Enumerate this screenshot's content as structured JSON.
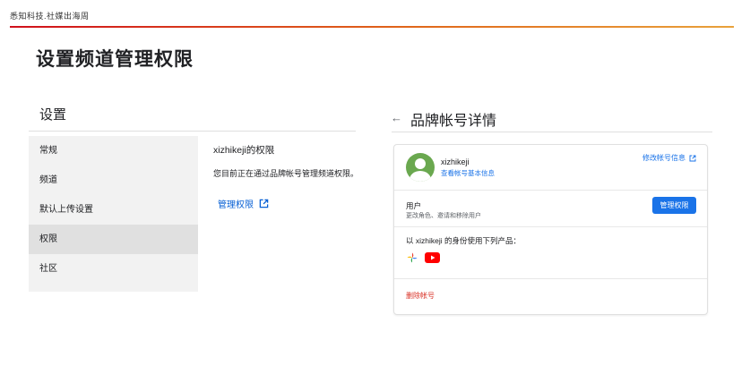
{
  "brand": "悉知科技.社媒出海周",
  "page_title": "设置频道管理权限",
  "settings": {
    "title": "设置",
    "nav": [
      {
        "label": "常规",
        "active": false
      },
      {
        "label": "频道",
        "active": false
      },
      {
        "label": "默认上传设置",
        "active": false
      },
      {
        "label": "权限",
        "active": true
      },
      {
        "label": "社区",
        "active": false
      }
    ],
    "permissions": {
      "title": "xizhikeji的权限",
      "desc": "您目前正在通过品牌帐号管理频道权限。",
      "manage_link": "管理权限"
    }
  },
  "brand_account": {
    "title": "品牌帐号详情",
    "account_name": "xizhikeji",
    "account_link": "查看帐号基本信息",
    "edit_link": "修改帐号信息",
    "users_label": "用户",
    "users_desc": "更改角色、邀请和移除用户",
    "manage_button": "管理权限",
    "products_label": "以 xizhikeji 的身份使用下列产品：",
    "products": [
      "google-photos-icon",
      "youtube-icon"
    ],
    "delete_link": "删除帐号"
  },
  "colors": {
    "accent": "#1a73e8",
    "delete": "#d93025",
    "avatar": "#6aa84f",
    "brand_rule_start": "#d0101c",
    "brand_rule_end": "#e9a23b"
  }
}
